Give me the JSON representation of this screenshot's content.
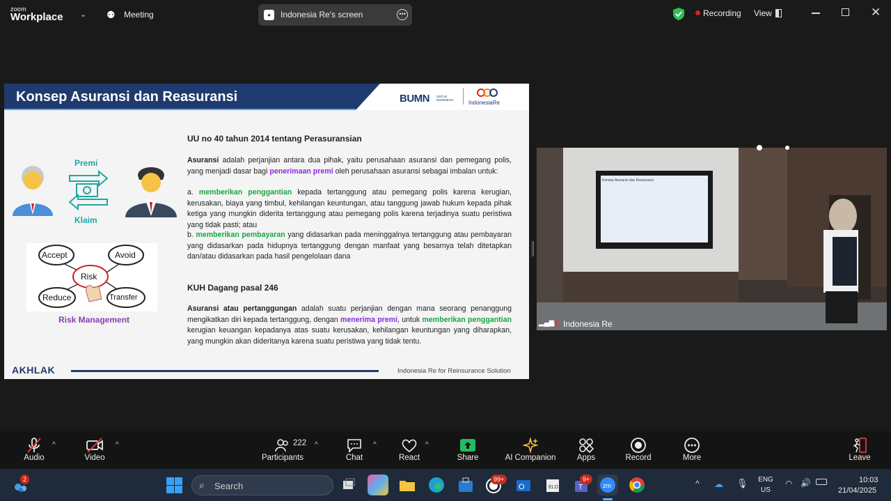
{
  "topbar": {
    "logo_small": "zoom",
    "logo_big": "Workplace",
    "meeting_label": "Meeting",
    "screen_pill_label": "Indonesia Re's screen",
    "recording_label": "Recording",
    "view_label": "View",
    "colors": {
      "recording_dot": "#e02020",
      "shield": "#2fbf4f"
    }
  },
  "slide": {
    "title": "Konsep Asuransi dan Reasuransi",
    "brand_bumn": "BUMN",
    "brand_bumn_sub": "UNTUK INDONESIA",
    "brand_logo_text": "IndonesiaRe",
    "premi_label": "Premi",
    "klaim_label": "Klaim",
    "risk_center": "Risk",
    "risk_accept": "Accept",
    "risk_avoid": "Avoid",
    "risk_reduce": "Reduce",
    "risk_transfer": "Transfer",
    "risk_caption": "Risk Management",
    "heading1": "UU no 40 tahun 2014 tentang Perasuransian",
    "p1_bold": "Asuransi",
    "p1_a": " adalah perjanjian antara dua pihak, yaitu perusahaan asuransi dan pemegang polis, yang menjadi dasar bagi ",
    "p1_purple": "penerimaan premi",
    "p1_b": " oleh perusahaan asuransi sebagai imbalan untuk:",
    "pa_prefix": "a. ",
    "pa_green": "memberikan penggantian",
    "pa_text": " kepada tertanggung atau pemegang polis karena kerugian, kerusakan, biaya yang timbul, kehilangan keuntungan, atau tanggung jawab hukum kepada pihak ketiga yang mungkin diderita tertanggung atau pemegang polis karena terjadinya suatu peristiwa yang tidak pasti; atau",
    "pb_prefix": "b. ",
    "pb_green": "memberikan pembayaran",
    "pb_text": " yang didasarkan pada meninggalnya tertanggung atau pembayaran yang didasarkan pada hidupnya tertanggung dengan manfaat yang besarnya telah ditetapkan dan/atau didasarkan pada hasil pengelolaan dana",
    "heading2": "KUH Dagang pasal 246",
    "p2_bold": "Asuransi atau pertanggungan",
    "p2_a": " adalah suatu perjanjian dengan mana seorang penanggung mengikatkan diri kepada tertanggung, dengan ",
    "p2_purple": "menerima premi",
    "p2_b": ", untuk ",
    "p2_green": "memberikan penggantian",
    "p2_c": " kerugian keuangan kepadanya atas suatu kerusakan, kehilangan keuntungan yang diharapkan, yang mungkin akan dideritanya karena suatu peristiwa yang tidak tentu.",
    "footer_left": "AKHLAK",
    "footer_right": "Indonesia Re for Reinsurance Solution",
    "colors": {
      "header": "#1f3a6e",
      "green": "#1aa640",
      "purple": "#8a2be2"
    }
  },
  "video": {
    "participant_name": "Indonesia Re",
    "tv_screen_text": "Konsep Asuransi dan Reasuransi"
  },
  "toolbar": {
    "audio": "Audio",
    "video": "Video",
    "participants": "Participants",
    "participants_count": "222",
    "chat": "Chat",
    "react": "React",
    "share": "Share",
    "ai_companion": "AI Companion",
    "apps": "Apps",
    "record": "Record",
    "more": "More",
    "leave": "Leave",
    "colors": {
      "share": "#1fbf5f",
      "leave": "#e03a3a",
      "ai": "#f5c542"
    }
  },
  "taskbar": {
    "search_placeholder": "Search",
    "notif_badge": "2",
    "whatsapp_badge": "99+",
    "teams_badge": "9+",
    "lang_line1": "ENG",
    "lang_line2": "US",
    "time": "10:03",
    "date": "21/04/2025"
  }
}
